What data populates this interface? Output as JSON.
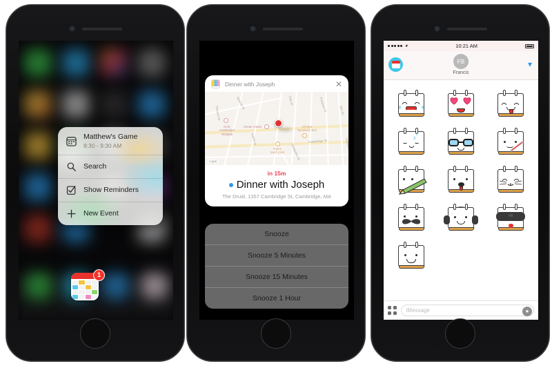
{
  "phone1": {
    "name": "iphone-home-screen-3d-touch",
    "quick_actions_menu": {
      "items": [
        {
          "icon": "calendar-event-icon",
          "label": "Matthew's Game",
          "sublabel": "8:30 - 9:30 AM"
        },
        {
          "icon": "search-icon",
          "label": "Search",
          "sublabel": ""
        },
        {
          "icon": "checkbox-icon",
          "label": "Show Reminders",
          "sublabel": ""
        },
        {
          "icon": "plus-icon",
          "label": "New Event",
          "sublabel": ""
        }
      ]
    },
    "app_icon": {
      "name": "calendar-app-icon",
      "badge": "1"
    }
  },
  "phone2": {
    "name": "iphone-notification-snooze",
    "notification": {
      "app_title": "Dinner with Joseph",
      "close_label": "✕",
      "when": "in 15m",
      "title": "Dinner with Joseph",
      "address": "The Druid, 1357 Cambridge St, Cambridge, MA",
      "map": {
        "legal": "Legal",
        "places": [
          {
            "label": "CHA\nCambridge\nHospital"
          },
          {
            "label": "Inman Oasis"
          },
          {
            "label": "All Star\nSandwich Bar"
          },
          {
            "label": "Ryles\nJazz Club"
          }
        ],
        "streets": [
          "Beacon St",
          "Oak St",
          "Prospect St",
          "Elm St",
          "Cambridge St",
          "Columbia St",
          "Hampshire St",
          "Antrim St",
          "Tremont St"
        ]
      }
    },
    "snooze_options": [
      "Snooze",
      "Snooze 5 Minutes",
      "Snooze 15 Minutes",
      "Snooze 1 Hour"
    ]
  },
  "phone3": {
    "name": "imessage-sticker-pack",
    "statusbar": {
      "time": "10:21 AM",
      "wifi_icon": "wifi-icon",
      "battery_icon": "battery-icon"
    },
    "header": {
      "app_icon": "calendar-sticker-app-icon",
      "avatar_initials": "FB",
      "contact_name": "Francis",
      "chevron_icon": "chevron-down-icon"
    },
    "stickers": [
      [
        {
          "name": "laughing-calendar-sticker",
          "expr": "laugh"
        },
        {
          "name": "heart-eyes-calendar-sticker",
          "expr": "heart"
        },
        {
          "name": "tongue-out-calendar-sticker",
          "expr": "tongue"
        }
      ],
      [
        {
          "name": "sleepy-calendar-sticker",
          "expr": "sleepy"
        },
        {
          "name": "nerd-glasses-calendar-sticker",
          "expr": "nerd"
        },
        {
          "name": "sick-thermometer-calendar-sticker",
          "expr": "sick"
        }
      ],
      [
        {
          "name": "pencil-calendar-sticker",
          "expr": "pencil"
        },
        {
          "name": "dog-calendar-sticker",
          "expr": "dog"
        },
        {
          "name": "cat-calendar-sticker",
          "expr": "cat"
        }
      ],
      [
        {
          "name": "mustache-calendar-sticker",
          "expr": "mustache"
        },
        {
          "name": "headphones-calendar-sticker",
          "expr": "headphones"
        },
        {
          "name": "vr-headset-calendar-sticker",
          "expr": "vr"
        }
      ],
      [
        {
          "name": "smiling-calendar-sticker",
          "expr": "smile"
        }
      ]
    ],
    "input_bar": {
      "apps_icon": "apps-grid-icon",
      "placeholder": "iMessage",
      "mic_icon": "microphone-icon"
    }
  },
  "colors": {
    "calendar_red": "#e8322b",
    "notif_accent": "#e8455c",
    "event_dot_blue": "#2f9ae8",
    "imessage_blue": "#2f9ae8",
    "badge_red": "#f5342b"
  }
}
